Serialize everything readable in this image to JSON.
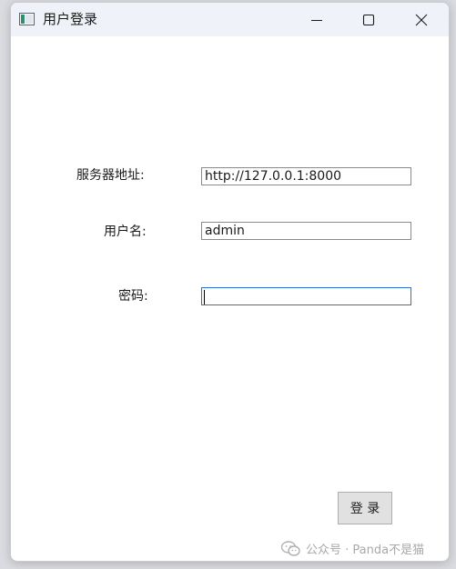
{
  "window": {
    "title": "用户登录"
  },
  "titlebar": {
    "minimize_icon": "minimize-icon",
    "maximize_icon": "maximize-icon",
    "close_icon": "close-icon"
  },
  "form": {
    "server_label": "服务器地址:",
    "server_value": "http://127.0.0.1:8000",
    "username_label": "用户名:",
    "username_value": "admin",
    "password_label": "密码:",
    "password_value": ""
  },
  "actions": {
    "login_label": "登 录"
  },
  "watermark": {
    "text": "公众号 · Panda不是猫",
    "icon": "wechat-icon"
  },
  "colors": {
    "titlebar_bg": "#eff2f8",
    "focus_border": "#2f6fd0",
    "button_bg": "#e1e1e1"
  }
}
